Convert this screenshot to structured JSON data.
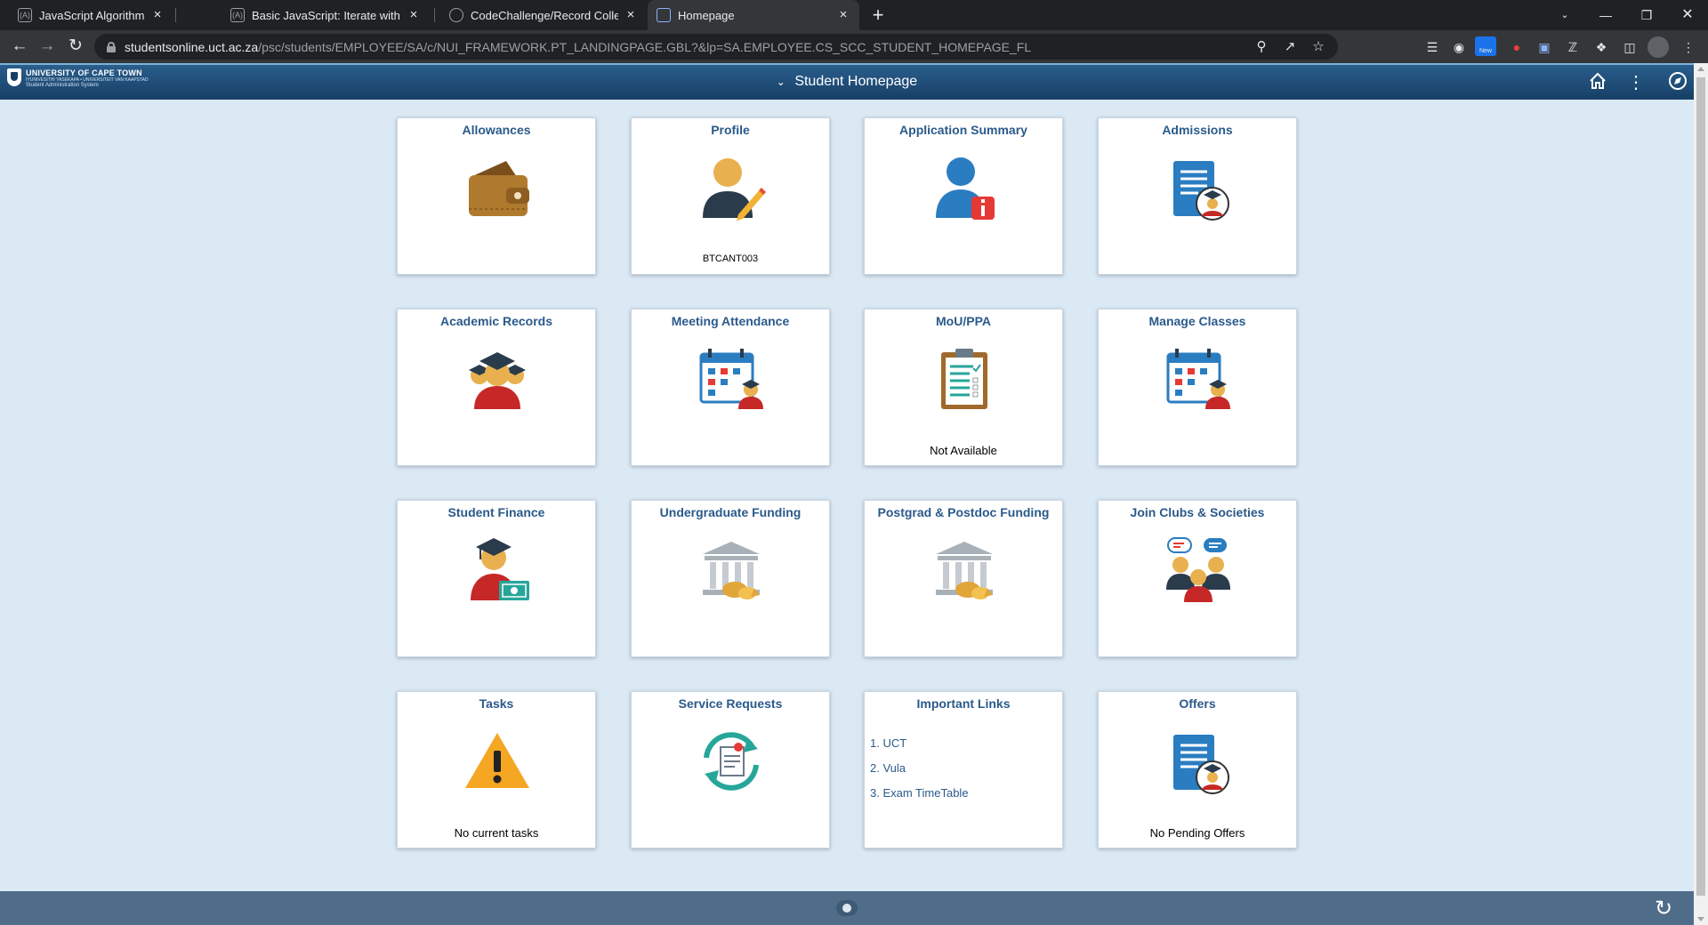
{
  "browser": {
    "tabs": [
      {
        "title": "JavaScript Algorithms and Data S",
        "favicon": "(A)"
      },
      {
        "title": "Basic JavaScript: Iterate with Java",
        "favicon": "(A)"
      },
      {
        "title": "CodeChallenge/Record Collection",
        "favicon": ""
      },
      {
        "title": "Homepage",
        "favicon": ""
      }
    ],
    "close_glyph": "×",
    "new_tab_glyph": "+",
    "url_host": "studentsonline.uct.ac.za",
    "url_path": "/psc/students/EMPLOYEE/SA/c/NUI_FRAMEWORK.PT_LANDINGPAGE.GBL?&lp=SA.EMPLOYEE.CS_SCC_STUDENT_HOMEPAGE_FL",
    "ext_new_badge": "New"
  },
  "header": {
    "logo_line1": "UNIVERSITY OF CAPE TOWN",
    "logo_line2": "IYUNIVESITHI YASEKAPA • UNIVERSITEIT VAN KAAPSTAD",
    "logo_line3": "Student Administration System",
    "title": "Student Homepage"
  },
  "tiles": [
    {
      "title": "Allowances",
      "icon": "wallet-icon"
    },
    {
      "title": "Profile",
      "icon": "user-edit-icon",
      "footer": "BTCANT003"
    },
    {
      "title": "Application Summary",
      "icon": "user-info-icon"
    },
    {
      "title": "Admissions",
      "icon": "document-graduate-icon"
    },
    {
      "title": "Academic Records",
      "icon": "graduates-icon"
    },
    {
      "title": "Meeting Attendance",
      "icon": "calendar-graduate-icon"
    },
    {
      "title": "MoU/PPA",
      "icon": "clipboard-icon",
      "footer": "Not Available"
    },
    {
      "title": "Manage Classes",
      "icon": "calendar-graduate-icon"
    },
    {
      "title": "Student Finance",
      "icon": "graduate-money-icon"
    },
    {
      "title": "Undergraduate Funding",
      "icon": "bank-coins-icon"
    },
    {
      "title": "Postgrad & Postdoc Funding",
      "icon": "bank-coins-icon"
    },
    {
      "title": "Join Clubs & Societies",
      "icon": "people-chat-icon"
    },
    {
      "title": "Tasks",
      "icon": "warning-icon",
      "footer": "No current tasks"
    },
    {
      "title": "Service Requests",
      "icon": "document-sync-icon"
    },
    {
      "title": "Important Links",
      "links": [
        "1. UCT",
        "2. Vula",
        "3. Exam TimeTable"
      ]
    },
    {
      "title": "Offers",
      "icon": "document-graduate-icon",
      "footer": "No Pending Offers"
    }
  ]
}
